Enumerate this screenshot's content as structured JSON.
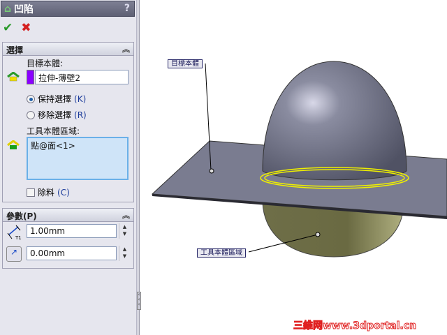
{
  "panel": {
    "title": "凹陷",
    "help": "?",
    "ok": "✔",
    "cancel": "✖",
    "selection": {
      "header": "選擇",
      "target_label": "目標本體:",
      "target_value": "拉伸-薄壁2",
      "target_color": "#8a00ff",
      "keep": "保持選擇",
      "keep_key": "(K)",
      "remove": "移除選擇",
      "remove_key": "(R)",
      "tool_label": "工具本體區域:",
      "tool_value": "點@面<1>",
      "cut": "除料",
      "cut_key": "(C)"
    },
    "params": {
      "header": "參數(P)",
      "thickness": "1.00mm",
      "clearance": "0.00mm"
    }
  },
  "viewport": {
    "callout_target": "目標本體",
    "callout_tool": "工具本體區域",
    "watermark": "三維网www.3dportal.cn"
  }
}
